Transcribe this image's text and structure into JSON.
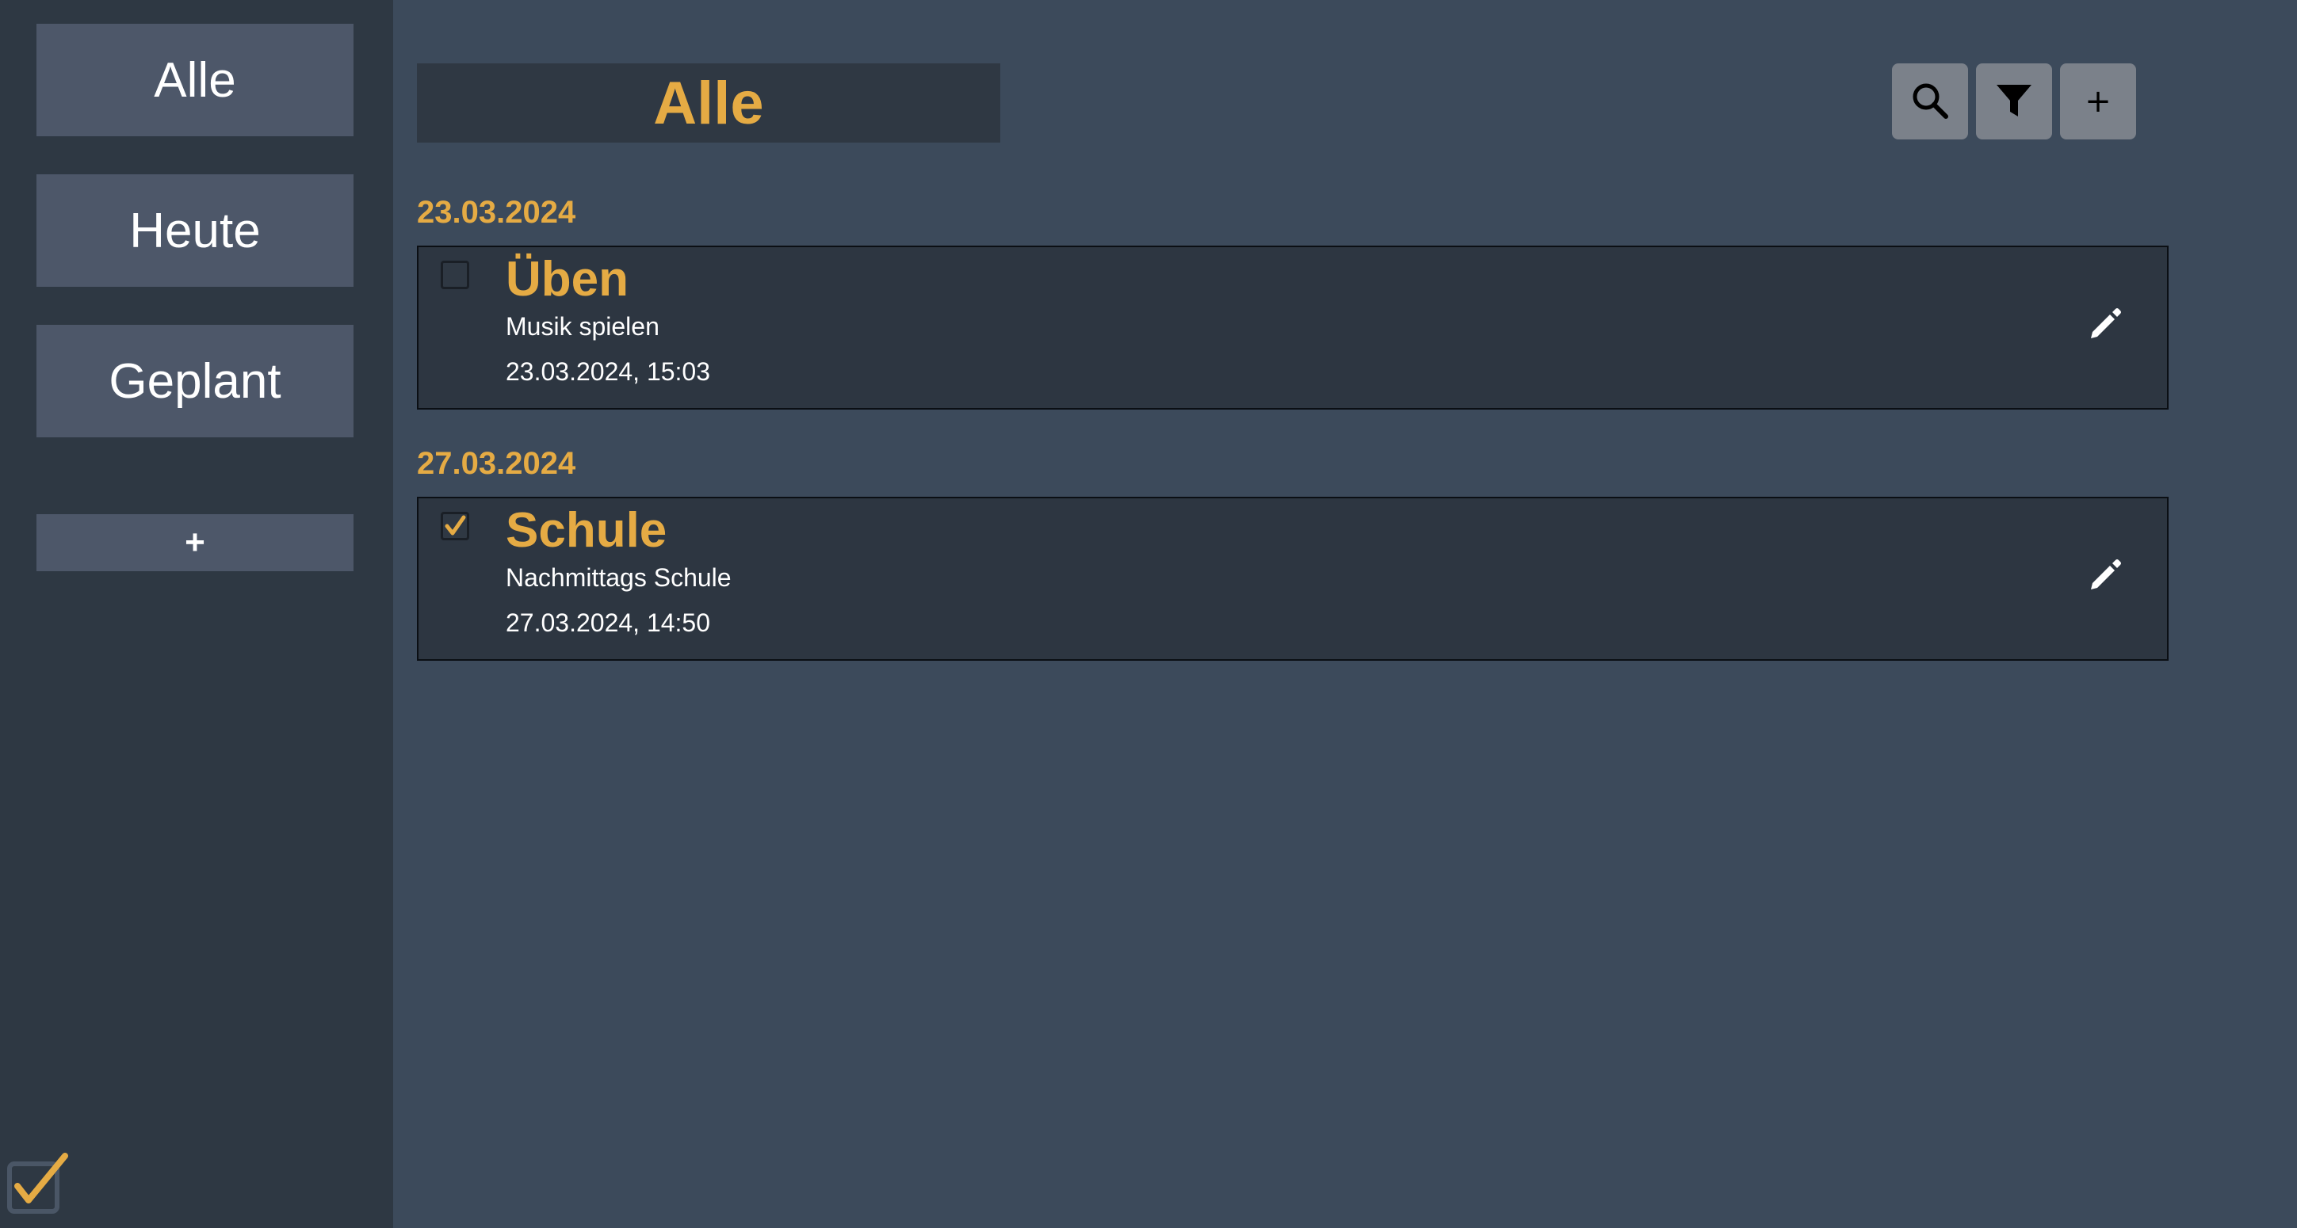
{
  "sidebar": {
    "items": [
      {
        "label": "Alle"
      },
      {
        "label": "Heute"
      },
      {
        "label": "Geplant"
      }
    ],
    "add_label": "+"
  },
  "header": {
    "title": "Alle",
    "add_label": "+"
  },
  "icons": {
    "search": "search-icon",
    "filter": "filter-icon",
    "edit": "pencil-icon",
    "logo": "checkmark-logo-icon"
  },
  "colors": {
    "accent": "#e5ab44",
    "sidebar_bg": "#2e3843",
    "main_bg": "#3c4a5b",
    "button_bg": "#4d5769",
    "card_bg": "#2d3641"
  },
  "groups": [
    {
      "date": "23.03.2024",
      "tasks": [
        {
          "title": "Üben",
          "description": "Musik spielen",
          "datetime": "23.03.2024, 15:03",
          "done": false
        }
      ]
    },
    {
      "date": "27.03.2024",
      "tasks": [
        {
          "title": "Schule",
          "description": "Nachmittags Schule",
          "datetime": "27.03.2024, 14:50",
          "done": true
        }
      ]
    }
  ]
}
